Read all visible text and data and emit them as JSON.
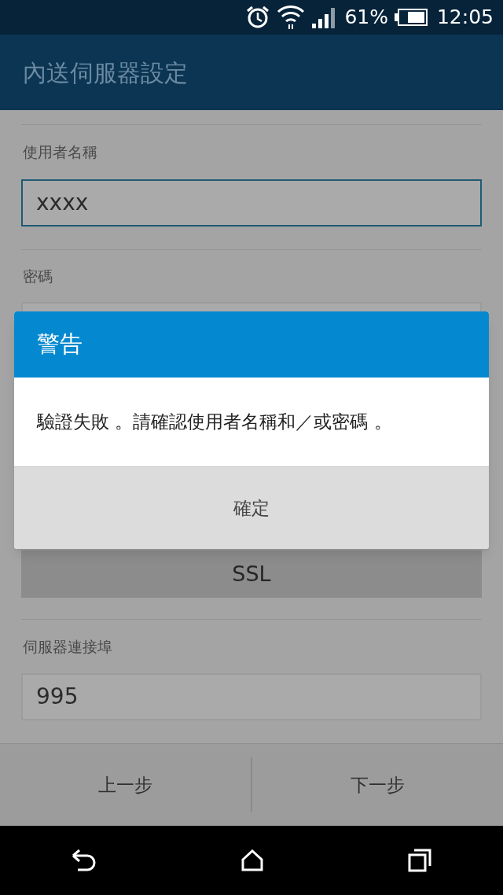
{
  "status_bar": {
    "battery": "61%",
    "time": "12:05"
  },
  "app_bar": {
    "title": "內送伺服器設定"
  },
  "form": {
    "username": {
      "label": "使用者名稱",
      "value": "xxxx",
      "focused": true
    },
    "password": {
      "label": "密碼"
    },
    "security_button": "SSL",
    "port": {
      "label": "伺服器連接埠",
      "value": "995",
      "focused": false
    }
  },
  "bottom_buttons": [
    "上一步",
    "下一步"
  ],
  "dialog": {
    "title": "警告",
    "message": "驗證失敗 。請確認使用者名稱和／或密碼 。",
    "button": "確定"
  }
}
